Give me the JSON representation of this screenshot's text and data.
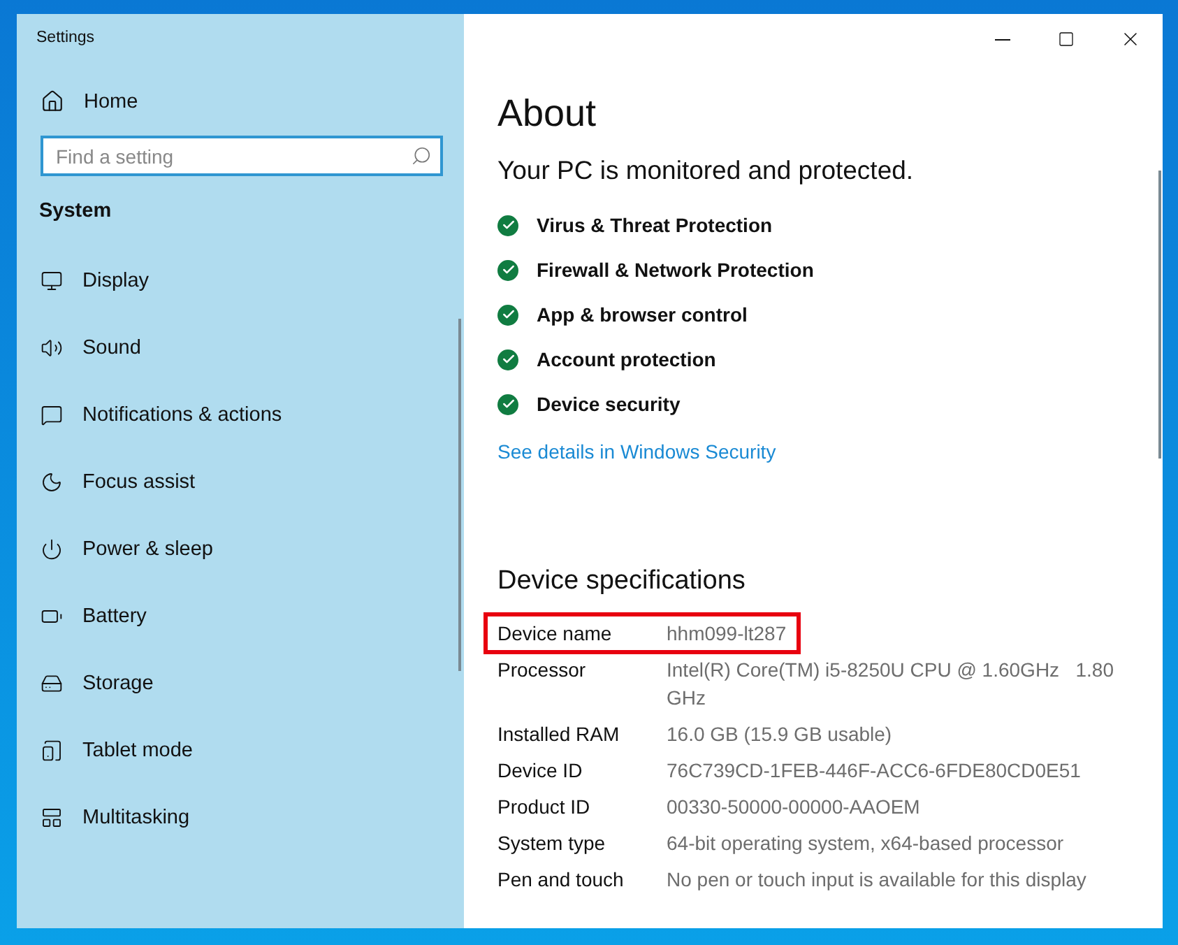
{
  "window": {
    "title": "Settings"
  },
  "sidebar": {
    "home": "Home",
    "search": {
      "placeholder": "Find a setting"
    },
    "section": "System",
    "items": [
      {
        "label": "Display"
      },
      {
        "label": "Sound"
      },
      {
        "label": "Notifications & actions"
      },
      {
        "label": "Focus assist"
      },
      {
        "label": "Power & sleep"
      },
      {
        "label": "Battery"
      },
      {
        "label": "Storage"
      },
      {
        "label": "Tablet mode"
      },
      {
        "label": "Multitasking"
      }
    ]
  },
  "main": {
    "title": "About",
    "protection_heading": "Your PC is monitored and protected.",
    "protections": [
      {
        "label": "Virus & Threat Protection",
        "ok": true
      },
      {
        "label": "Firewall & Network Protection",
        "ok": true
      },
      {
        "label": "App & browser control",
        "ok": true
      },
      {
        "label": "Account protection",
        "ok": true
      },
      {
        "label": "Device security",
        "ok": true
      }
    ],
    "link": "See details in Windows Security",
    "specs_heading": "Device specifications",
    "specs": [
      {
        "label": "Device name",
        "value": "hhm099-lt287",
        "highlighted": true
      },
      {
        "label": "Processor",
        "value": "Intel(R) Core(TM) i5-8250U CPU @ 1.60GHz   1.80 GHz",
        "highlighted": false
      },
      {
        "label": "Installed RAM",
        "value": "16.0 GB (15.9 GB usable)",
        "highlighted": false
      },
      {
        "label": "Device ID",
        "value": "76C739CD-1FEB-446F-ACC6-6FDE80CD0E51",
        "highlighted": false
      },
      {
        "label": "Product ID",
        "value": "00330-50000-00000-AAOEM",
        "highlighted": false
      },
      {
        "label": "System type",
        "value": "64-bit operating system, x64-based processor",
        "highlighted": false
      },
      {
        "label": "Pen and touch",
        "value": "No pen or touch input is available for this display",
        "highlighted": false
      }
    ]
  }
}
